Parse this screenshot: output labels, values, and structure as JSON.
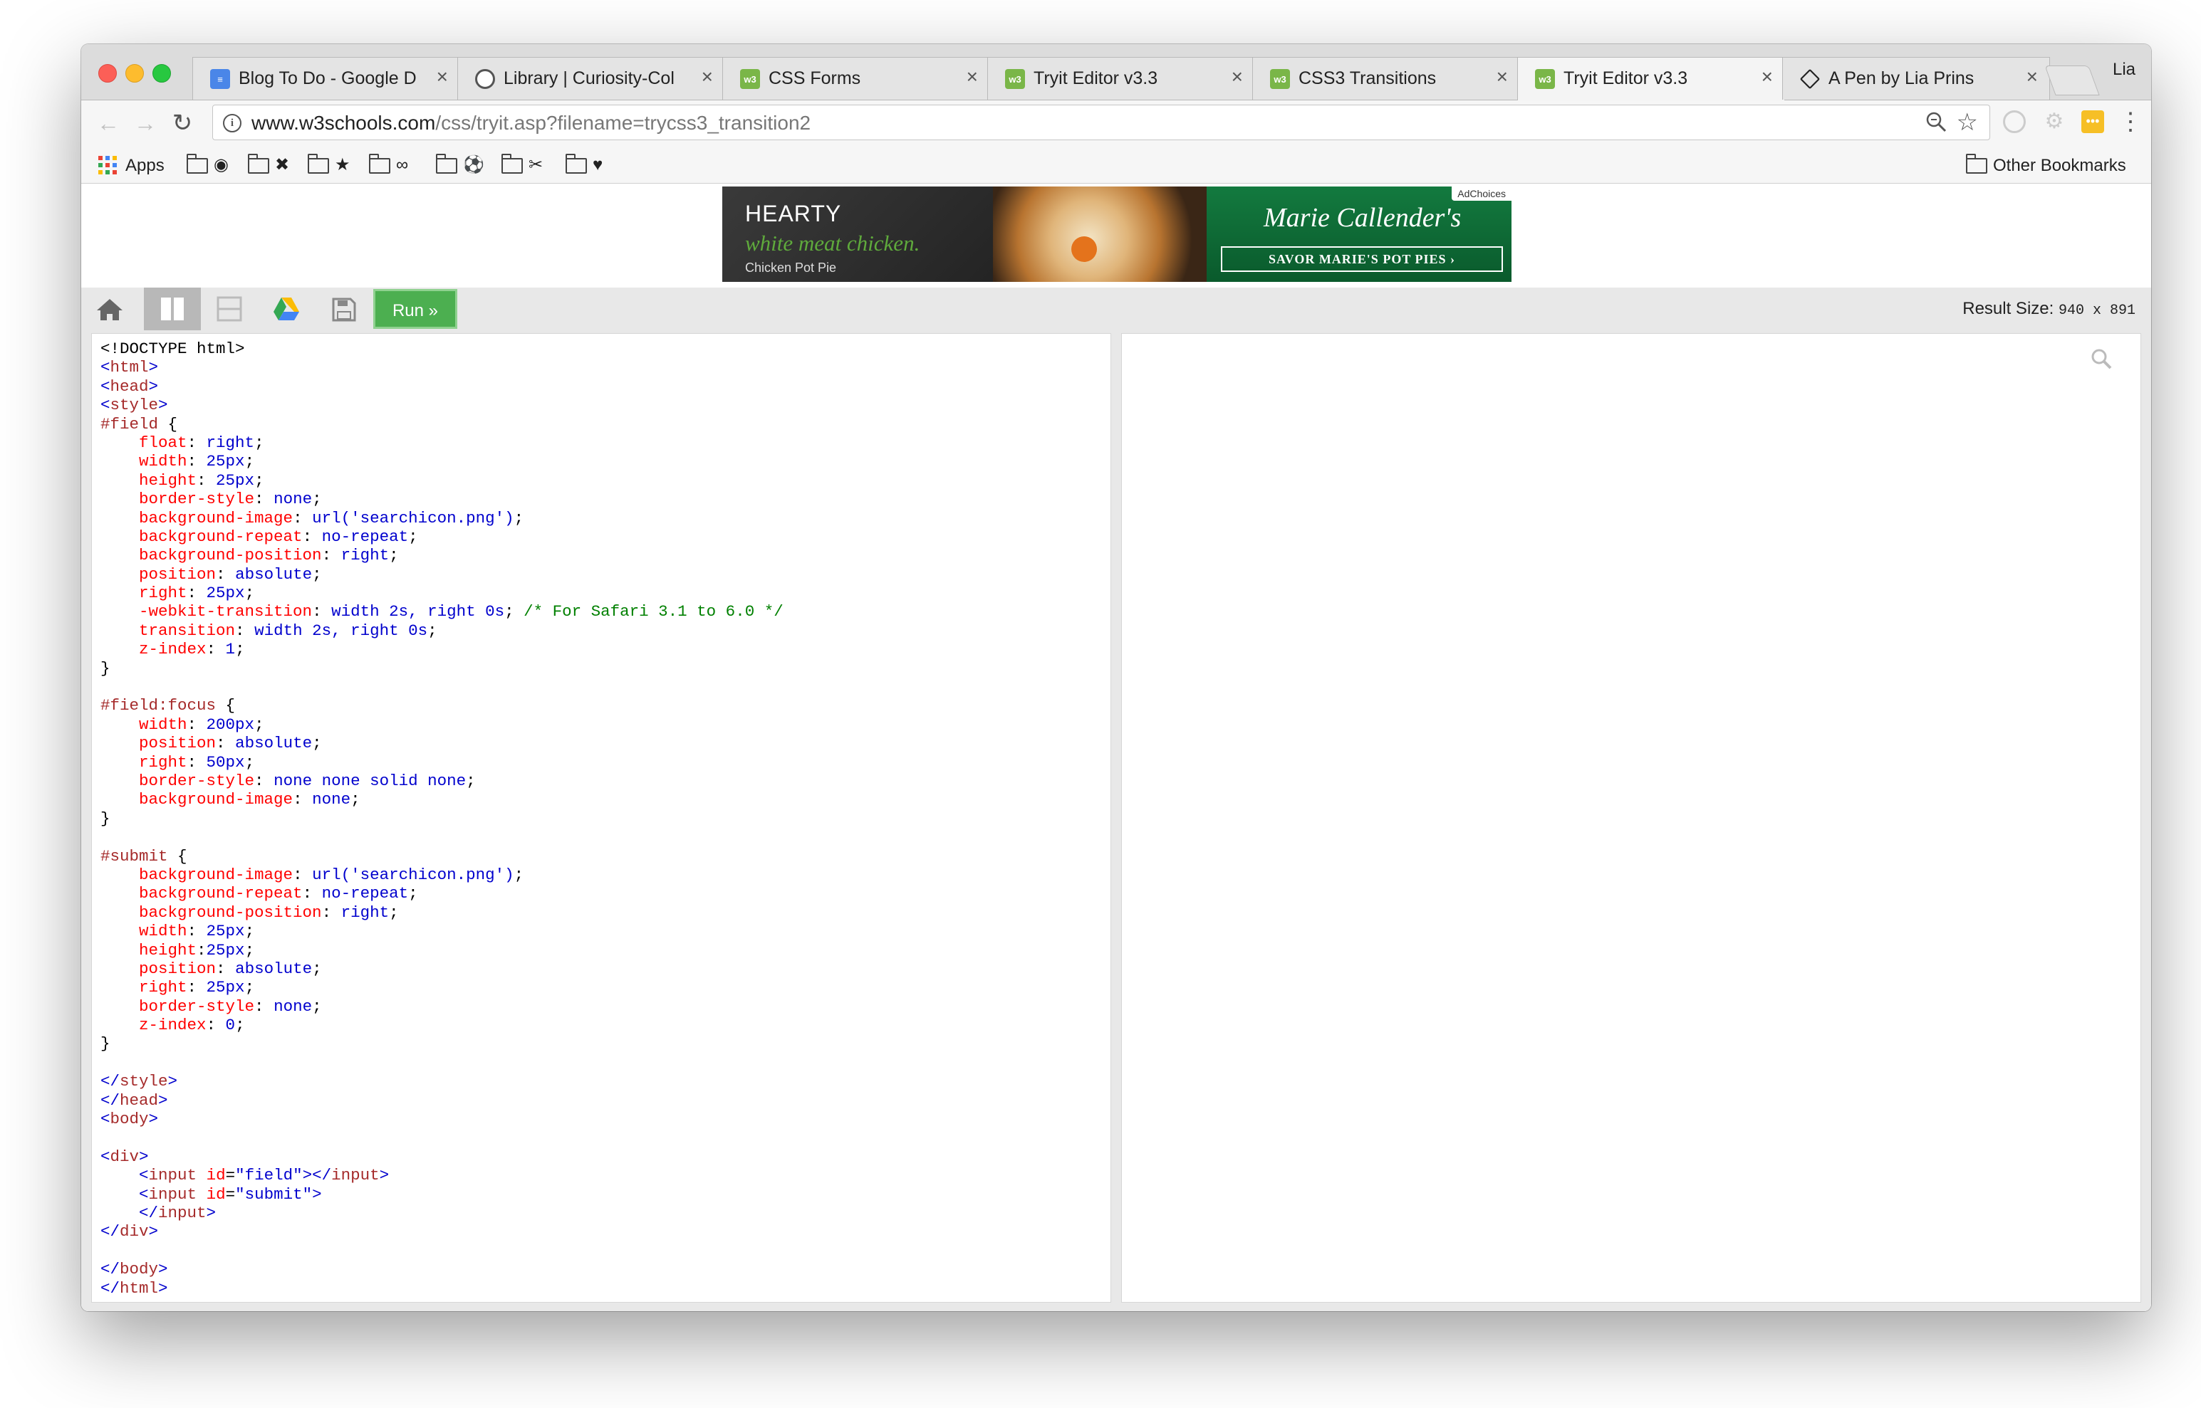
{
  "browser": {
    "tabs": [
      {
        "title": "Blog To Do - Google D",
        "icon": "google-docs-icon",
        "active": false
      },
      {
        "title": "Library | Curiosity-Col",
        "icon": "curiosity-icon",
        "active": false
      },
      {
        "title": "CSS Forms",
        "icon": "w3schools-icon",
        "active": false
      },
      {
        "title": "Tryit Editor v3.3",
        "icon": "w3schools-icon",
        "active": false
      },
      {
        "title": "CSS3 Transitions",
        "icon": "w3schools-icon",
        "active": false
      },
      {
        "title": "Tryit Editor v3.3",
        "icon": "w3schools-icon",
        "active": true
      },
      {
        "title": "A Pen by Lia Prins",
        "icon": "codepen-icon",
        "active": false
      }
    ],
    "profile_name": "Lia",
    "url_host": "www.w3schools.com",
    "url_path": "/css/tryit.asp?filename=trycss3_transition2",
    "bookmarks": {
      "apps_label": "Apps",
      "folders": [
        "◉",
        "✖",
        "★",
        "∞",
        "⚽",
        "✂",
        "♥"
      ],
      "other_label": "Other Bookmarks"
    }
  },
  "ad": {
    "headline": "HEARTY",
    "tagline": "white meat chicken.",
    "product": "Chicken Pot Pie",
    "brand": "Marie Callender's",
    "cta": "SAVOR MARIE'S POT PIES ›",
    "adchoices": "AdChoices"
  },
  "editor": {
    "run_label": "Run »",
    "result_size_label": "Result Size:",
    "result_size_value": "940 x 891",
    "code_lines": [
      [
        [
          "#000000",
          "<!DOCTYPE html>"
        ]
      ],
      [
        [
          "#0000cd",
          "<"
        ],
        [
          "#a52a2a",
          "html"
        ],
        [
          "#0000cd",
          ">"
        ]
      ],
      [
        [
          "#0000cd",
          "<"
        ],
        [
          "#a52a2a",
          "head"
        ],
        [
          "#0000cd",
          ">"
        ]
      ],
      [
        [
          "#0000cd",
          "<"
        ],
        [
          "#a52a2a",
          "style"
        ],
        [
          "#0000cd",
          ">"
        ]
      ],
      [
        [
          "#a52a2a",
          "#field"
        ],
        [
          "#000000",
          " {"
        ]
      ],
      [
        [
          "#000000",
          "    "
        ],
        [
          "#ff0000",
          "float"
        ],
        [
          "#000000",
          ": "
        ],
        [
          "#0000cd",
          "right"
        ],
        [
          "#000000",
          ";"
        ]
      ],
      [
        [
          "#000000",
          "    "
        ],
        [
          "#ff0000",
          "width"
        ],
        [
          "#000000",
          ": "
        ],
        [
          "#0000cd",
          "25px"
        ],
        [
          "#000000",
          ";"
        ]
      ],
      [
        [
          "#000000",
          "    "
        ],
        [
          "#ff0000",
          "height"
        ],
        [
          "#000000",
          ": "
        ],
        [
          "#0000cd",
          "25px"
        ],
        [
          "#000000",
          ";"
        ]
      ],
      [
        [
          "#000000",
          "    "
        ],
        [
          "#ff0000",
          "border-style"
        ],
        [
          "#000000",
          ": "
        ],
        [
          "#0000cd",
          "none"
        ],
        [
          "#000000",
          ";"
        ]
      ],
      [
        [
          "#000000",
          "    "
        ],
        [
          "#ff0000",
          "background-image"
        ],
        [
          "#000000",
          ": "
        ],
        [
          "#0000cd",
          "url('searchicon.png')"
        ],
        [
          "#000000",
          ";"
        ]
      ],
      [
        [
          "#000000",
          "    "
        ],
        [
          "#ff0000",
          "background-repeat"
        ],
        [
          "#000000",
          ": "
        ],
        [
          "#0000cd",
          "no-repeat"
        ],
        [
          "#000000",
          ";"
        ]
      ],
      [
        [
          "#000000",
          "    "
        ],
        [
          "#ff0000",
          "background-position"
        ],
        [
          "#000000",
          ": "
        ],
        [
          "#0000cd",
          "right"
        ],
        [
          "#000000",
          ";"
        ]
      ],
      [
        [
          "#000000",
          "    "
        ],
        [
          "#ff0000",
          "position"
        ],
        [
          "#000000",
          ": "
        ],
        [
          "#0000cd",
          "absolute"
        ],
        [
          "#000000",
          ";"
        ]
      ],
      [
        [
          "#000000",
          "    "
        ],
        [
          "#ff0000",
          "right"
        ],
        [
          "#000000",
          ": "
        ],
        [
          "#0000cd",
          "25px"
        ],
        [
          "#000000",
          ";"
        ]
      ],
      [
        [
          "#000000",
          "    "
        ],
        [
          "#ff0000",
          "-webkit-transition"
        ],
        [
          "#000000",
          ": "
        ],
        [
          "#0000cd",
          "width 2s, right 0s"
        ],
        [
          "#000000",
          "; "
        ],
        [
          "#008000",
          "/* For Safari 3.1 to 6.0 */"
        ]
      ],
      [
        [
          "#000000",
          "    "
        ],
        [
          "#ff0000",
          "transition"
        ],
        [
          "#000000",
          ": "
        ],
        [
          "#0000cd",
          "width 2s, right 0s"
        ],
        [
          "#000000",
          ";"
        ]
      ],
      [
        [
          "#000000",
          "    "
        ],
        [
          "#ff0000",
          "z-index"
        ],
        [
          "#000000",
          ": "
        ],
        [
          "#0000cd",
          "1"
        ],
        [
          "#000000",
          ";"
        ]
      ],
      [
        [
          "#000000",
          "}"
        ]
      ],
      [
        [
          "#000000",
          ""
        ]
      ],
      [
        [
          "#a52a2a",
          "#field:focus"
        ],
        [
          "#000000",
          " {"
        ]
      ],
      [
        [
          "#000000",
          "    "
        ],
        [
          "#ff0000",
          "width"
        ],
        [
          "#000000",
          ": "
        ],
        [
          "#0000cd",
          "200px"
        ],
        [
          "#000000",
          ";"
        ]
      ],
      [
        [
          "#000000",
          "    "
        ],
        [
          "#ff0000",
          "position"
        ],
        [
          "#000000",
          ": "
        ],
        [
          "#0000cd",
          "absolute"
        ],
        [
          "#000000",
          ";"
        ]
      ],
      [
        [
          "#000000",
          "    "
        ],
        [
          "#ff0000",
          "right"
        ],
        [
          "#000000",
          ": "
        ],
        [
          "#0000cd",
          "50px"
        ],
        [
          "#000000",
          ";"
        ]
      ],
      [
        [
          "#000000",
          "    "
        ],
        [
          "#ff0000",
          "border-style"
        ],
        [
          "#000000",
          ": "
        ],
        [
          "#0000cd",
          "none none solid none"
        ],
        [
          "#000000",
          ";"
        ]
      ],
      [
        [
          "#000000",
          "    "
        ],
        [
          "#ff0000",
          "background-image"
        ],
        [
          "#000000",
          ": "
        ],
        [
          "#0000cd",
          "none"
        ],
        [
          "#000000",
          ";"
        ]
      ],
      [
        [
          "#000000",
          "}"
        ]
      ],
      [
        [
          "#000000",
          ""
        ]
      ],
      [
        [
          "#a52a2a",
          "#submit"
        ],
        [
          "#000000",
          " {"
        ]
      ],
      [
        [
          "#000000",
          "    "
        ],
        [
          "#ff0000",
          "background-image"
        ],
        [
          "#000000",
          ": "
        ],
        [
          "#0000cd",
          "url('searchicon.png')"
        ],
        [
          "#000000",
          ";"
        ]
      ],
      [
        [
          "#000000",
          "    "
        ],
        [
          "#ff0000",
          "background-repeat"
        ],
        [
          "#000000",
          ": "
        ],
        [
          "#0000cd",
          "no-repeat"
        ],
        [
          "#000000",
          ";"
        ]
      ],
      [
        [
          "#000000",
          "    "
        ],
        [
          "#ff0000",
          "background-position"
        ],
        [
          "#000000",
          ": "
        ],
        [
          "#0000cd",
          "right"
        ],
        [
          "#000000",
          ";"
        ]
      ],
      [
        [
          "#000000",
          "    "
        ],
        [
          "#ff0000",
          "width"
        ],
        [
          "#000000",
          ": "
        ],
        [
          "#0000cd",
          "25px"
        ],
        [
          "#000000",
          ";"
        ]
      ],
      [
        [
          "#000000",
          "    "
        ],
        [
          "#ff0000",
          "height"
        ],
        [
          "#000000",
          ":"
        ],
        [
          "#0000cd",
          "25px"
        ],
        [
          "#000000",
          ";"
        ]
      ],
      [
        [
          "#000000",
          "    "
        ],
        [
          "#ff0000",
          "position"
        ],
        [
          "#000000",
          ": "
        ],
        [
          "#0000cd",
          "absolute"
        ],
        [
          "#000000",
          ";"
        ]
      ],
      [
        [
          "#000000",
          "    "
        ],
        [
          "#ff0000",
          "right"
        ],
        [
          "#000000",
          ": "
        ],
        [
          "#0000cd",
          "25px"
        ],
        [
          "#000000",
          ";"
        ]
      ],
      [
        [
          "#000000",
          "    "
        ],
        [
          "#ff0000",
          "border-style"
        ],
        [
          "#000000",
          ": "
        ],
        [
          "#0000cd",
          "none"
        ],
        [
          "#000000",
          ";"
        ]
      ],
      [
        [
          "#000000",
          "    "
        ],
        [
          "#ff0000",
          "z-index"
        ],
        [
          "#000000",
          ": "
        ],
        [
          "#0000cd",
          "0"
        ],
        [
          "#000000",
          ";"
        ]
      ],
      [
        [
          "#000000",
          "}"
        ]
      ],
      [
        [
          "#000000",
          ""
        ]
      ],
      [
        [
          "#0000cd",
          "</"
        ],
        [
          "#a52a2a",
          "style"
        ],
        [
          "#0000cd",
          ">"
        ]
      ],
      [
        [
          "#0000cd",
          "</"
        ],
        [
          "#a52a2a",
          "head"
        ],
        [
          "#0000cd",
          ">"
        ]
      ],
      [
        [
          "#0000cd",
          "<"
        ],
        [
          "#a52a2a",
          "body"
        ],
        [
          "#0000cd",
          ">"
        ]
      ],
      [
        [
          "#000000",
          ""
        ]
      ],
      [
        [
          "#0000cd",
          "<"
        ],
        [
          "#a52a2a",
          "div"
        ],
        [
          "#0000cd",
          ">"
        ]
      ],
      [
        [
          "#000000",
          "    "
        ],
        [
          "#0000cd",
          "<"
        ],
        [
          "#a52a2a",
          "input"
        ],
        [
          "#000000",
          " "
        ],
        [
          "#ff0000",
          "id"
        ],
        [
          "#000000",
          "="
        ],
        [
          "#0000cd",
          "\"field\""
        ],
        [
          "#0000cd",
          "></"
        ],
        [
          "#a52a2a",
          "input"
        ],
        [
          "#0000cd",
          ">"
        ]
      ],
      [
        [
          "#000000",
          "    "
        ],
        [
          "#0000cd",
          "<"
        ],
        [
          "#a52a2a",
          "input"
        ],
        [
          "#000000",
          " "
        ],
        [
          "#ff0000",
          "id"
        ],
        [
          "#000000",
          "="
        ],
        [
          "#0000cd",
          "\"submit\""
        ],
        [
          "#0000cd",
          ">"
        ]
      ],
      [
        [
          "#000000",
          "    "
        ],
        [
          "#0000cd",
          "</"
        ],
        [
          "#a52a2a",
          "input"
        ],
        [
          "#0000cd",
          ">"
        ]
      ],
      [
        [
          "#0000cd",
          "</"
        ],
        [
          "#a52a2a",
          "div"
        ],
        [
          "#0000cd",
          ">"
        ]
      ],
      [
        [
          "#000000",
          ""
        ]
      ],
      [
        [
          "#0000cd",
          "</"
        ],
        [
          "#a52a2a",
          "body"
        ],
        [
          "#0000cd",
          ">"
        ]
      ],
      [
        [
          "#0000cd",
          "</"
        ],
        [
          "#a52a2a",
          "html"
        ],
        [
          "#0000cd",
          ">"
        ]
      ]
    ]
  }
}
